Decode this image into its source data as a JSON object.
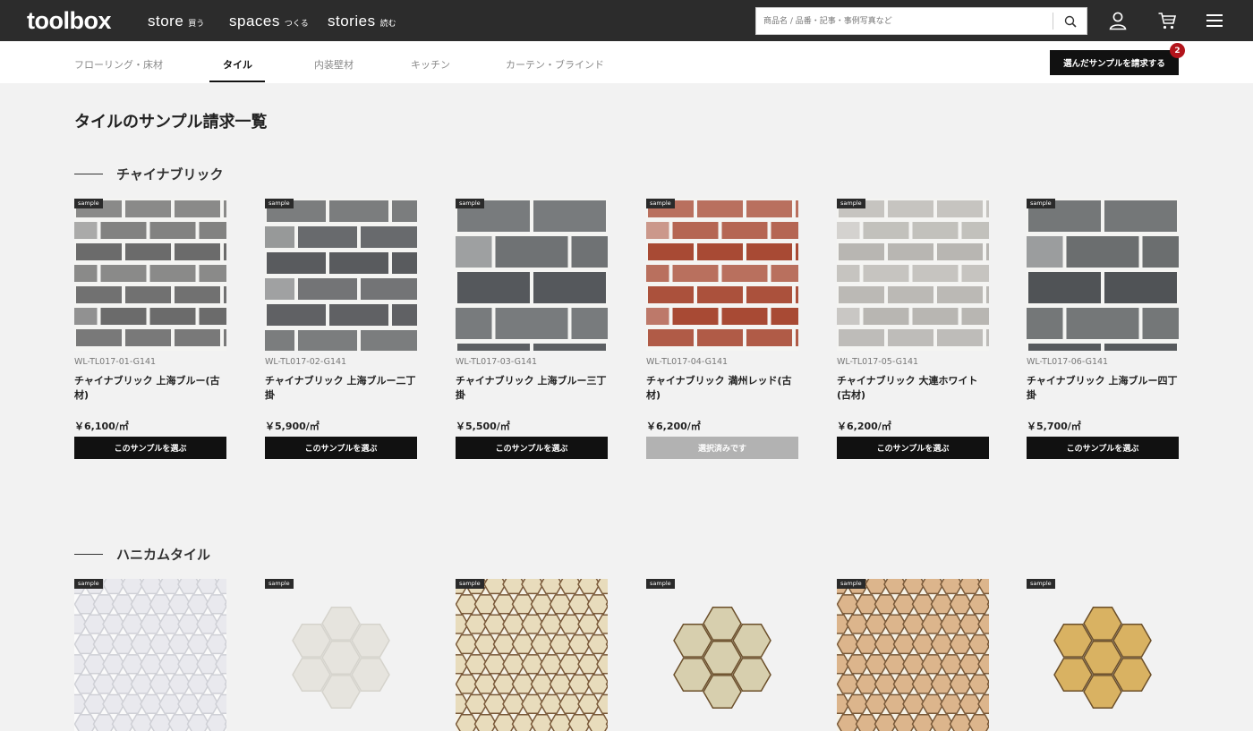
{
  "header": {
    "logo": "toolbox",
    "nav": [
      {
        "label": "store",
        "sub": "買う"
      },
      {
        "label": "spaces",
        "sub": "つくる"
      },
      {
        "label": "stories",
        "sub": "読む"
      }
    ],
    "search_placeholder": "商品名 / 品番・記事・事例写真など",
    "icons": [
      "search-icon",
      "user-icon",
      "cart-icon",
      "menu-icon"
    ]
  },
  "categories": [
    "フローリング・床材",
    "タイル",
    "内装壁材",
    "キッチン",
    "カーテン・ブラインド"
  ],
  "active_category": "タイル",
  "request_button": {
    "label": "選んだサンプルを請求する",
    "count": "2"
  },
  "page_title": "タイルのサンプル請求一覧",
  "colors": {
    "topbar": "#2c2c2c",
    "accent_badge": "#b3141b",
    "button": "#111111",
    "button_selected": "#b2b2b2"
  },
  "sections": [
    {
      "title": "チャイナブリック",
      "products": [
        {
          "tag": "sample",
          "code": "WL-TL017-01-G141",
          "name": "チャイナブリック 上海ブルー(古材)",
          "price": "￥6,100/㎡",
          "button": "このサンプルを選ぶ",
          "selected": false,
          "color": "#6b6b6b"
        },
        {
          "tag": "sample",
          "code": "WL-TL017-02-G141",
          "name": "チャイナブリック 上海ブルー二丁掛",
          "price": "￥5,900/㎡",
          "button": "このサンプルを選ぶ",
          "selected": false,
          "color": "#595b5e"
        },
        {
          "tag": "sample",
          "code": "WL-TL017-03-G141",
          "name": "チャイナブリック 上海ブルー三丁掛",
          "price": "￥5,500/㎡",
          "button": "このサンプルを選ぶ",
          "selected": false,
          "color": "#55585c"
        },
        {
          "tag": "sample",
          "code": "WL-TL017-04-G141",
          "name": "チャイナブリック 満州レッド(古材)",
          "price": "￥6,200/㎡",
          "button": "選択済みです",
          "selected": true,
          "color": "#a84a34"
        },
        {
          "tag": "sample",
          "code": "WL-TL017-05-G141",
          "name": "チャイナブリック 大連ホワイト(古材)",
          "price": "￥6,200/㎡",
          "button": "このサンプルを選ぶ",
          "selected": false,
          "color": "#b8b6b2"
        },
        {
          "tag": "sample",
          "code": "WL-TL017-06-G141",
          "name": "チャイナブリック 上海ブルー四丁掛",
          "price": "￥5,700/㎡",
          "button": "このサンプルを選ぶ",
          "selected": false,
          "color": "#505356"
        }
      ]
    },
    {
      "title": "ハニカムタイル",
      "products": [
        {
          "tag": "sample",
          "color": "#e9e9ee"
        },
        {
          "tag": "sample",
          "color": "#e6e4de"
        },
        {
          "tag": "sample",
          "color": "#e8dcbc"
        },
        {
          "tag": "sample",
          "color": "#d7cfae"
        },
        {
          "tag": "sample",
          "color": "#dcb58c"
        },
        {
          "tag": "sample",
          "color": "#d9b262"
        }
      ]
    }
  ]
}
